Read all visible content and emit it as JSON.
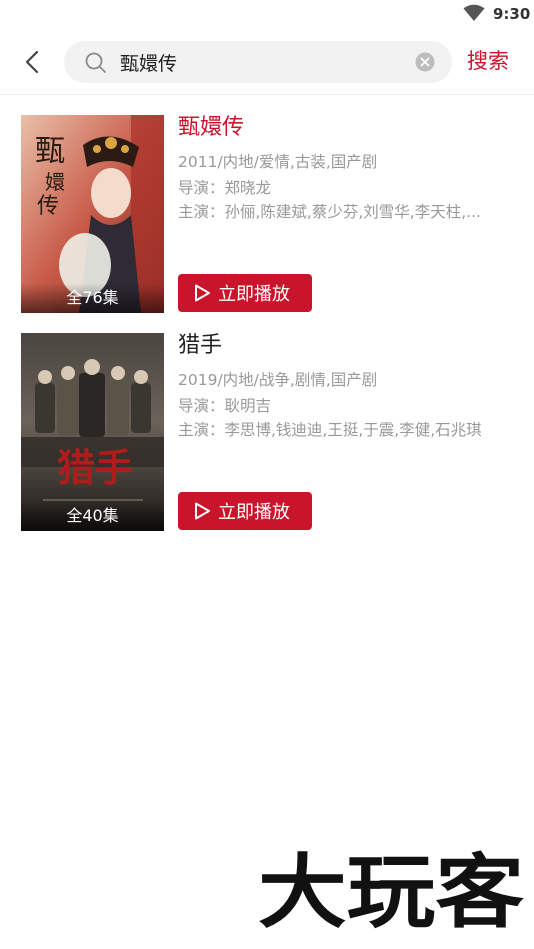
{
  "status_bar": {
    "time": "9:30"
  },
  "search": {
    "query": "甄嬛传",
    "button_label": "搜索"
  },
  "results": [
    {
      "title": "甄嬛传",
      "title_color": "#c9152b",
      "episodes": "全76集",
      "info": "2011/内地/爱情,古装,国产剧",
      "director": "导演：郑晓龙",
      "cast": "主演：孙俪,陈建斌,蔡少芬,刘雪华,李天柱,...",
      "play_label": "立即播放"
    },
    {
      "title": "猎手",
      "title_color": "#222222",
      "episodes": "全40集",
      "info": "2019/内地/战争,剧情,国产剧",
      "director": "导演：耿明吉",
      "cast": "主演：李思博,钱迪迪,王挺,于震,李健,石兆琪",
      "play_label": "立即播放"
    }
  ],
  "watermark": {
    "text": "大玩客"
  },
  "colors": {
    "accent": "#c9152b",
    "meta_text": "#999999",
    "search_bg": "#f2f2f2"
  }
}
